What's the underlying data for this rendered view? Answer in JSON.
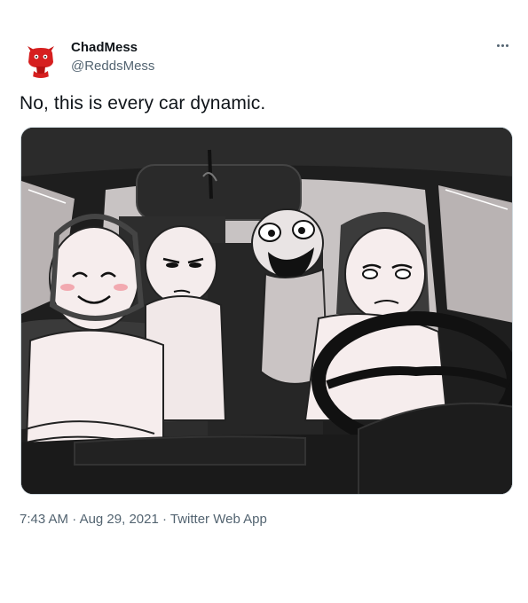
{
  "author": {
    "name": "ChadMess",
    "handle": "@ReddsMess",
    "avatar_icon": "red-devil-avatar-icon"
  },
  "more_icon": "ellipsis-icon",
  "tweet": {
    "text": "No, this is every car dynamic."
  },
  "media": {
    "type": "illustration",
    "subject_icon": "car-dynamic-illustration"
  },
  "meta": {
    "time": "7:43 AM",
    "separator": " · ",
    "date": "Aug 29, 2021",
    "source": "Twitter Web App"
  },
  "colors": {
    "text_primary": "#0f1419",
    "text_secondary": "#536471",
    "avatar_red": "#d61f1f"
  }
}
